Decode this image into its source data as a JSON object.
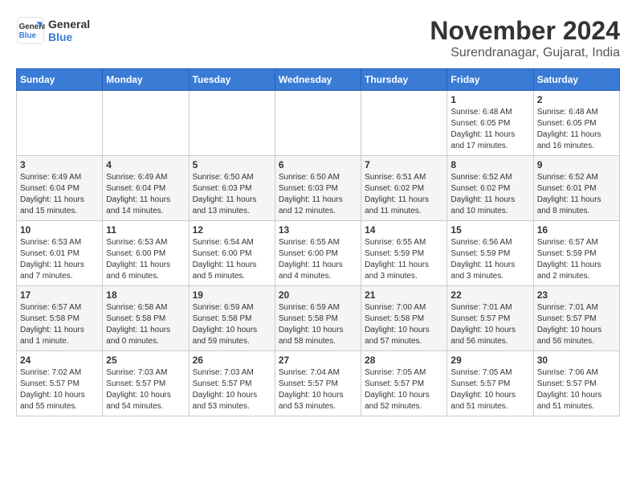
{
  "header": {
    "logo": {
      "line1": "General",
      "line2": "Blue"
    },
    "month": "November 2024",
    "location": "Surendranagar, Gujarat, India"
  },
  "weekdays": [
    "Sunday",
    "Monday",
    "Tuesday",
    "Wednesday",
    "Thursday",
    "Friday",
    "Saturday"
  ],
  "weeks": [
    [
      {
        "day": "",
        "info": ""
      },
      {
        "day": "",
        "info": ""
      },
      {
        "day": "",
        "info": ""
      },
      {
        "day": "",
        "info": ""
      },
      {
        "day": "",
        "info": ""
      },
      {
        "day": "1",
        "info": "Sunrise: 6:48 AM\nSunset: 6:05 PM\nDaylight: 11 hours and 17 minutes."
      },
      {
        "day": "2",
        "info": "Sunrise: 6:48 AM\nSunset: 6:05 PM\nDaylight: 11 hours and 16 minutes."
      }
    ],
    [
      {
        "day": "3",
        "info": "Sunrise: 6:49 AM\nSunset: 6:04 PM\nDaylight: 11 hours and 15 minutes."
      },
      {
        "day": "4",
        "info": "Sunrise: 6:49 AM\nSunset: 6:04 PM\nDaylight: 11 hours and 14 minutes."
      },
      {
        "day": "5",
        "info": "Sunrise: 6:50 AM\nSunset: 6:03 PM\nDaylight: 11 hours and 13 minutes."
      },
      {
        "day": "6",
        "info": "Sunrise: 6:50 AM\nSunset: 6:03 PM\nDaylight: 11 hours and 12 minutes."
      },
      {
        "day": "7",
        "info": "Sunrise: 6:51 AM\nSunset: 6:02 PM\nDaylight: 11 hours and 11 minutes."
      },
      {
        "day": "8",
        "info": "Sunrise: 6:52 AM\nSunset: 6:02 PM\nDaylight: 11 hours and 10 minutes."
      },
      {
        "day": "9",
        "info": "Sunrise: 6:52 AM\nSunset: 6:01 PM\nDaylight: 11 hours and 8 minutes."
      }
    ],
    [
      {
        "day": "10",
        "info": "Sunrise: 6:53 AM\nSunset: 6:01 PM\nDaylight: 11 hours and 7 minutes."
      },
      {
        "day": "11",
        "info": "Sunrise: 6:53 AM\nSunset: 6:00 PM\nDaylight: 11 hours and 6 minutes."
      },
      {
        "day": "12",
        "info": "Sunrise: 6:54 AM\nSunset: 6:00 PM\nDaylight: 11 hours and 5 minutes."
      },
      {
        "day": "13",
        "info": "Sunrise: 6:55 AM\nSunset: 6:00 PM\nDaylight: 11 hours and 4 minutes."
      },
      {
        "day": "14",
        "info": "Sunrise: 6:55 AM\nSunset: 5:59 PM\nDaylight: 11 hours and 3 minutes."
      },
      {
        "day": "15",
        "info": "Sunrise: 6:56 AM\nSunset: 5:59 PM\nDaylight: 11 hours and 3 minutes."
      },
      {
        "day": "16",
        "info": "Sunrise: 6:57 AM\nSunset: 5:59 PM\nDaylight: 11 hours and 2 minutes."
      }
    ],
    [
      {
        "day": "17",
        "info": "Sunrise: 6:57 AM\nSunset: 5:58 PM\nDaylight: 11 hours and 1 minute."
      },
      {
        "day": "18",
        "info": "Sunrise: 6:58 AM\nSunset: 5:58 PM\nDaylight: 11 hours and 0 minutes."
      },
      {
        "day": "19",
        "info": "Sunrise: 6:59 AM\nSunset: 5:58 PM\nDaylight: 10 hours and 59 minutes."
      },
      {
        "day": "20",
        "info": "Sunrise: 6:59 AM\nSunset: 5:58 PM\nDaylight: 10 hours and 58 minutes."
      },
      {
        "day": "21",
        "info": "Sunrise: 7:00 AM\nSunset: 5:58 PM\nDaylight: 10 hours and 57 minutes."
      },
      {
        "day": "22",
        "info": "Sunrise: 7:01 AM\nSunset: 5:57 PM\nDaylight: 10 hours and 56 minutes."
      },
      {
        "day": "23",
        "info": "Sunrise: 7:01 AM\nSunset: 5:57 PM\nDaylight: 10 hours and 56 minutes."
      }
    ],
    [
      {
        "day": "24",
        "info": "Sunrise: 7:02 AM\nSunset: 5:57 PM\nDaylight: 10 hours and 55 minutes."
      },
      {
        "day": "25",
        "info": "Sunrise: 7:03 AM\nSunset: 5:57 PM\nDaylight: 10 hours and 54 minutes."
      },
      {
        "day": "26",
        "info": "Sunrise: 7:03 AM\nSunset: 5:57 PM\nDaylight: 10 hours and 53 minutes."
      },
      {
        "day": "27",
        "info": "Sunrise: 7:04 AM\nSunset: 5:57 PM\nDaylight: 10 hours and 53 minutes."
      },
      {
        "day": "28",
        "info": "Sunrise: 7:05 AM\nSunset: 5:57 PM\nDaylight: 10 hours and 52 minutes."
      },
      {
        "day": "29",
        "info": "Sunrise: 7:05 AM\nSunset: 5:57 PM\nDaylight: 10 hours and 51 minutes."
      },
      {
        "day": "30",
        "info": "Sunrise: 7:06 AM\nSunset: 5:57 PM\nDaylight: 10 hours and 51 minutes."
      }
    ]
  ]
}
